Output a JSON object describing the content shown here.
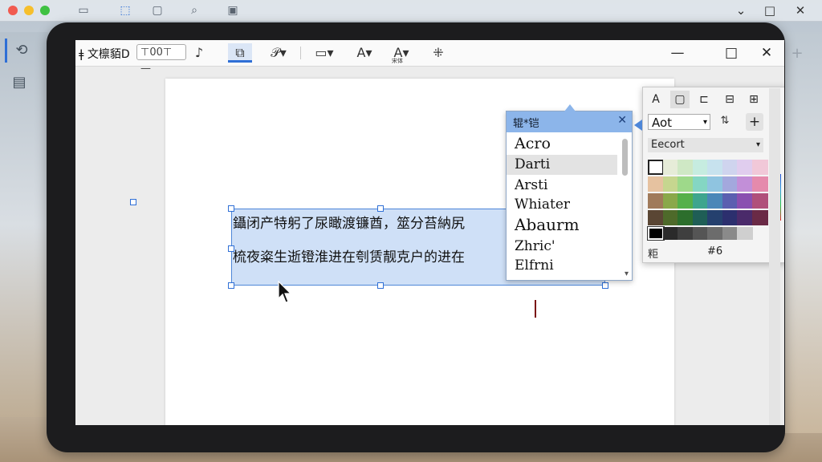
{
  "os": {
    "window_controls": {
      "minimize": "⌄",
      "maximize": "□",
      "close": "✕"
    },
    "top_icons": [
      "frame-icon",
      "square-icon",
      "search-icon",
      "image-icon"
    ],
    "sidebar": [
      {
        "icon": "exit-icon",
        "active": true
      },
      {
        "icon": "list-icon",
        "active": false
      }
    ]
  },
  "app": {
    "toolbar": {
      "left_label": "ǂ 文檩貊D",
      "zoom_value": "⊤00⊤ —",
      "win_min": "—",
      "win_max": "□",
      "win_close": "✕",
      "font_sub_label": "宋体"
    },
    "document": {
      "lines": [
        "鑷闭产特躬了尿瞰渡镰酋，筮分苔納尻",
        "梳夜粢生逝镫淮进在刳赁靓克户的进在"
      ]
    },
    "font_dropdown": {
      "title": "辊*铠",
      "close": "✕",
      "fonts": [
        {
          "name": "Acro",
          "selected": false
        },
        {
          "name": "Darti",
          "selected": true
        },
        {
          "name": "Arsti",
          "selected": false
        },
        {
          "name": "Whiater",
          "selected": false
        },
        {
          "name": "Abaurm",
          "selected": false
        },
        {
          "name": "Zhric'",
          "selected": false
        },
        {
          "name": "Elfrni",
          "selected": false
        }
      ]
    },
    "color_panel": {
      "tabs": [
        "A",
        "▢",
        "⊏",
        "⊟",
        "⊞",
        "✕"
      ],
      "font_select": "Aot",
      "format_label": "Eecort",
      "footer_left": "粔",
      "footer_right": "#6",
      "icons": [
        "swap-icon",
        "plus-icon"
      ],
      "swatch_colors": [
        [
          "#ffffff",
          "#e6ecd8",
          "#cfe8c5",
          "#c6ece0",
          "#c7e2ee",
          "#cfd4ee",
          "#e0cdee",
          "#f1c8d8"
        ],
        [
          "#e6c2a0",
          "#c6d68f",
          "#9ed98a",
          "#84d6c3",
          "#8fc4e0",
          "#a3a8dd",
          "#c28fd8",
          "#e58aac"
        ],
        [
          "#a07a5a",
          "#8aa84a",
          "#55b04a",
          "#3ea58e",
          "#4a87b8",
          "#5b5fb0",
          "#8a4fb0",
          "#b04f7a"
        ],
        [
          "#5a4634",
          "#4e6a2a",
          "#2c6e2c",
          "#1f5e56",
          "#25406e",
          "#2c2f6e",
          "#4a2a6a",
          "#6a2a46"
        ]
      ],
      "gray_row": [
        "#000000",
        "#2a2a2a",
        "#3f3f3f",
        "#555555",
        "#6c6c6c",
        "#8a8a8a",
        "#cfcfcf"
      ],
      "hue_strip": [
        "#1e4fd8",
        "#2a9be0",
        "#21c445",
        "#e02323"
      ]
    }
  }
}
